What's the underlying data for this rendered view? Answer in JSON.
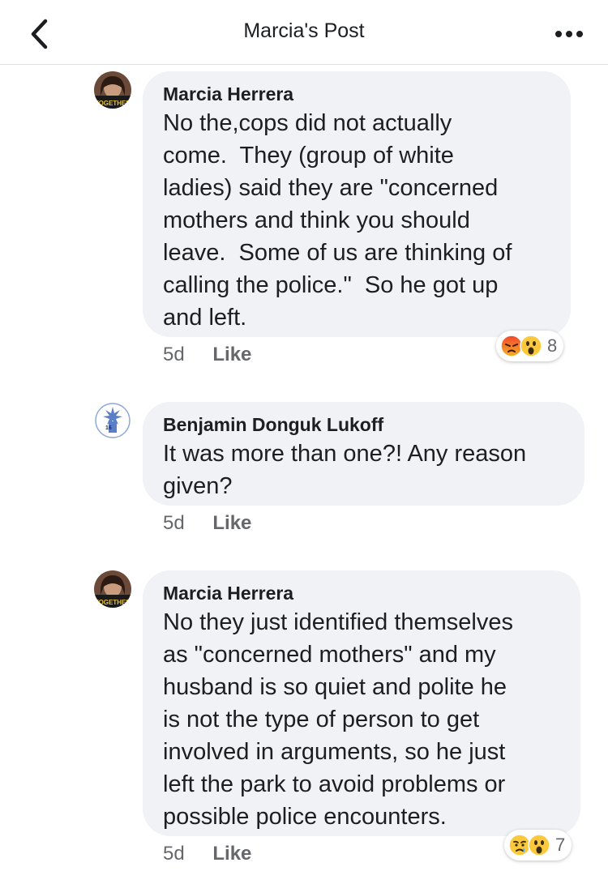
{
  "header": {
    "title": "Marcia's Post",
    "back_icon": "chevron-left-icon",
    "more_icon": "more-horizontal-icon"
  },
  "comments": [
    {
      "author": "Marcia Herrera",
      "avatar_text": "TOGETHER",
      "text": "No the,cops did not actually\ncome.  They (group of white\nladies) said they are \"concerned\nmothers and think you should\nleave.  Some of us are thinking of\ncalling the police.\"  So he got up\nand left.",
      "time": "5d",
      "like_label": "Like",
      "reactions": [
        "angry",
        "wow"
      ],
      "reaction_count": "8"
    },
    {
      "author": "Benjamin Donguk Lukoff",
      "avatar_text": "16",
      "text": "It was more than one?! Any reason\ngiven?",
      "time": "5d",
      "like_label": "Like"
    },
    {
      "author": "Marcia Herrera",
      "avatar_text": "TOGETHER",
      "text": "No they just identified themselves\nas \"concerned mothers\" and my\nhusband is so quiet and polite he\nis not the type of person to get\ninvolved in arguments, so he just\nleft the park to avoid problems or\npossible police encounters.",
      "time": "5d",
      "like_label": "Like",
      "reactions": [
        "sad",
        "wow"
      ],
      "reaction_count": "7"
    }
  ],
  "colors": {
    "bubble": "#f0f2f5",
    "meta_text": "#65676b",
    "divider": "#dddfe2"
  }
}
